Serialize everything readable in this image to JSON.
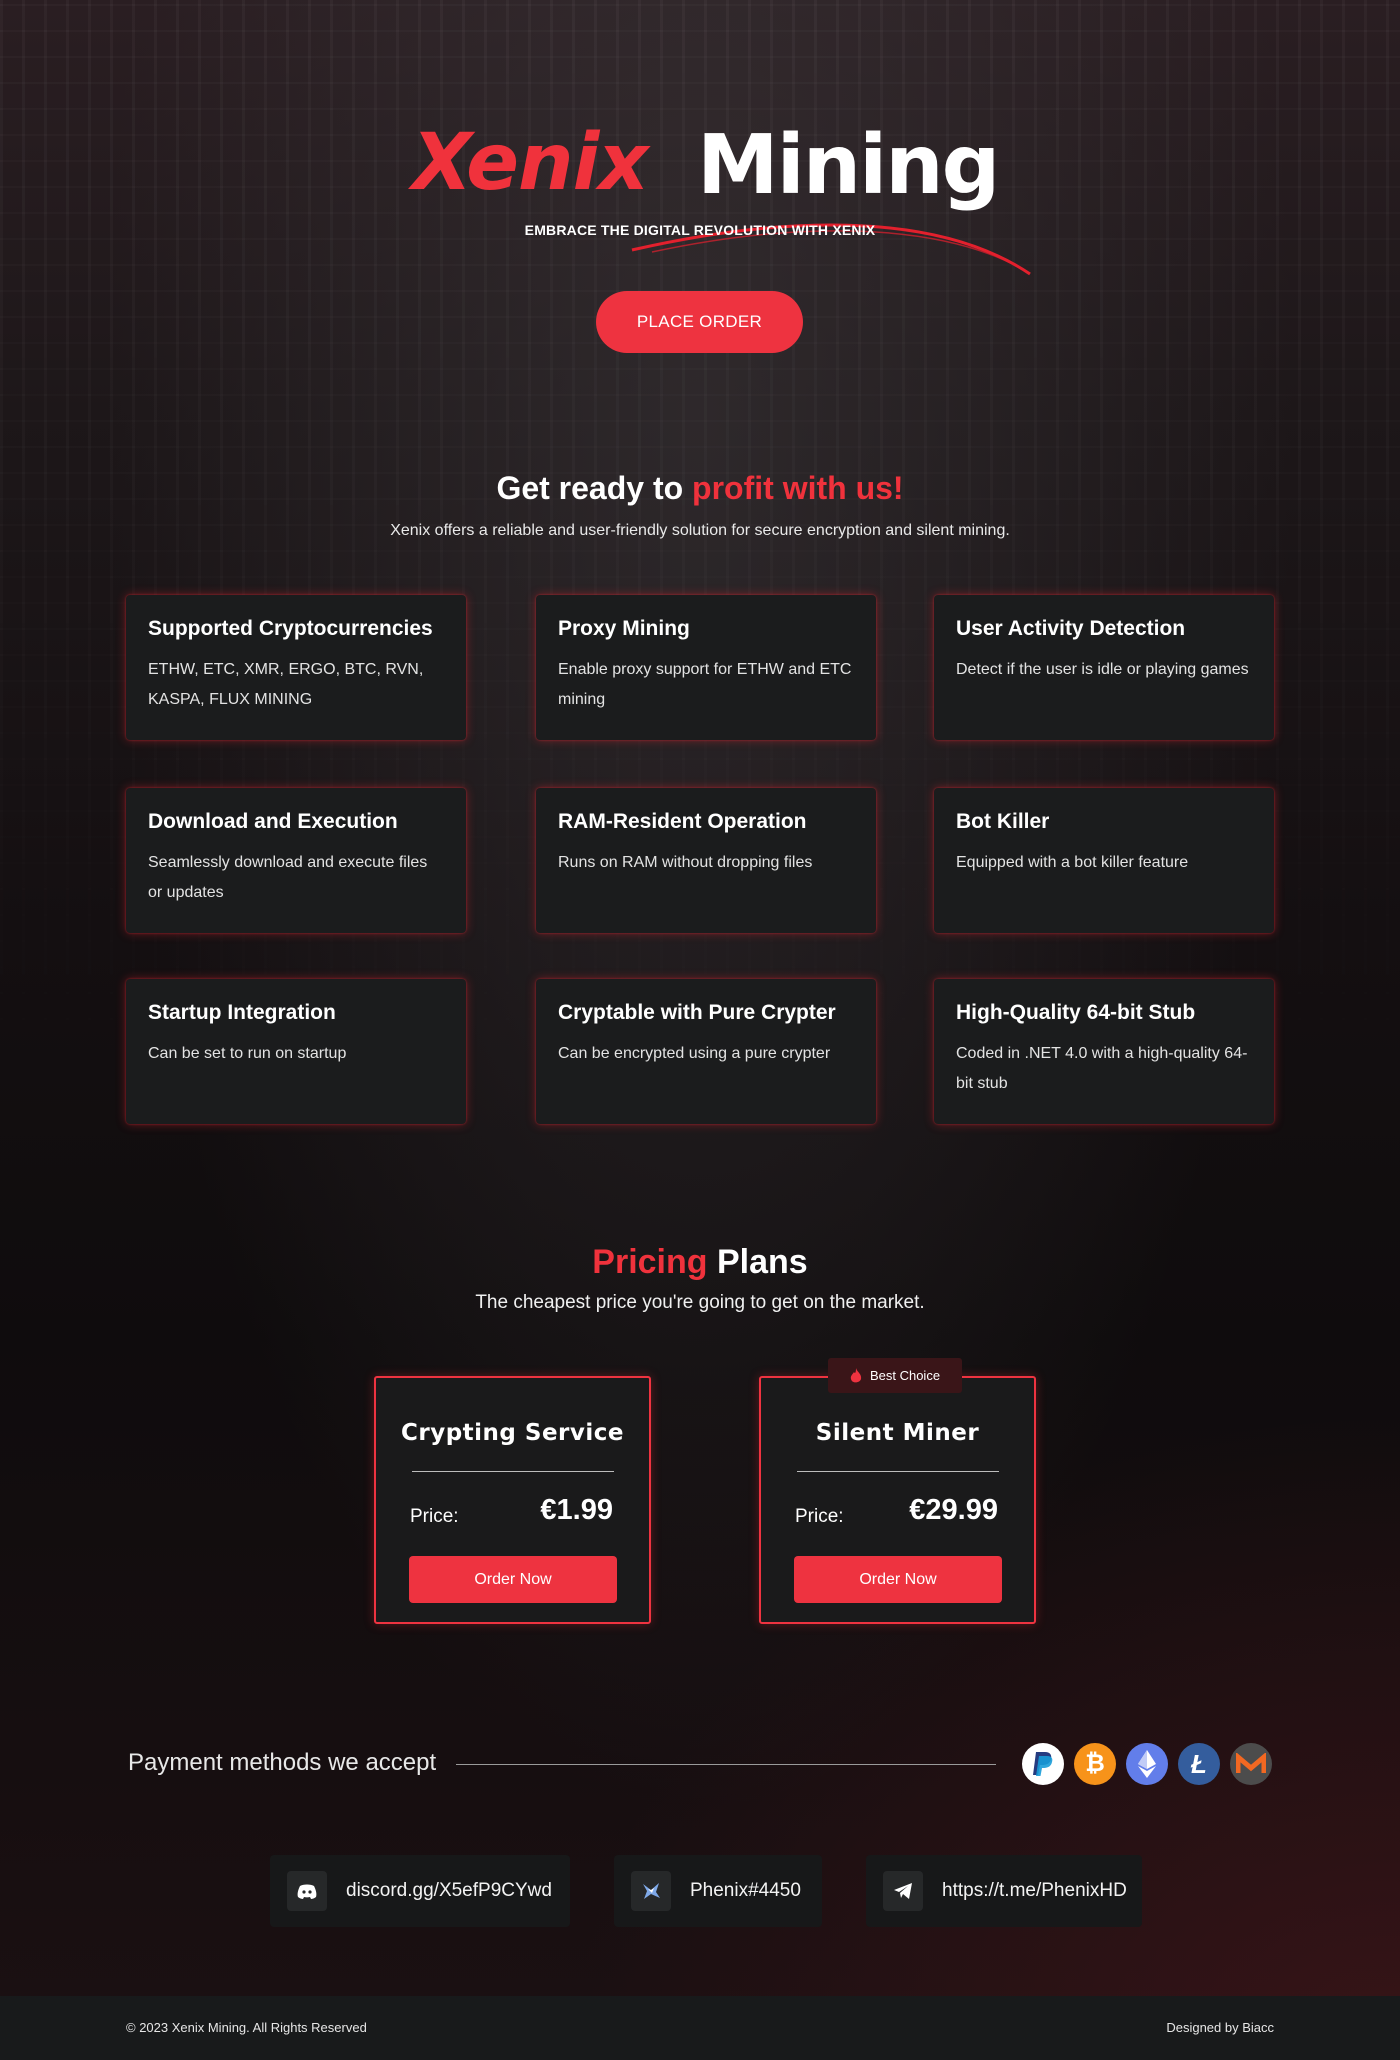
{
  "hero": {
    "logo_word1": "Xenix",
    "logo_word2": "Mining",
    "tagline": "EMBRACE THE DIGITAL REVOLUTION WITH XENIX",
    "cta_label": "PLACE ORDER"
  },
  "intro": {
    "title_plain": "Get ready to ",
    "title_accent": "profit with us!",
    "subtitle": "Xenix offers a reliable and user-friendly solution for secure encryption and silent mining."
  },
  "features": [
    {
      "title": "Supported Cryptocurrencies",
      "text": "ETHW, ETC, XMR, ERGO, BTC, RVN, KASPA, FLUX MINING"
    },
    {
      "title": "Proxy Mining",
      "text": "Enable proxy support for ETHW and ETC mining"
    },
    {
      "title": "User Activity Detection",
      "text": "Detect if the user is idle or playing games"
    },
    {
      "title": "Download and Execution",
      "text": "Seamlessly download and execute files or updates"
    },
    {
      "title": "RAM-Resident Operation",
      "text": "Runs on RAM without dropping files"
    },
    {
      "title": "Bot Killer",
      "text": "Equipped with a bot killer feature"
    },
    {
      "title": "Startup Integration",
      "text": "Can be set to run on startup"
    },
    {
      "title": "Cryptable with Pure Crypter",
      "text": "Can be encrypted using a pure crypter"
    },
    {
      "title": "High-Quality 64-bit Stub",
      "text": "Coded in .NET 4.0 with a high-quality 64-bit stub"
    }
  ],
  "pricing": {
    "title_accent": "Pricing",
    "title_plain": " Plans",
    "subtitle": "The cheapest price you're going to get on the market.",
    "plans": [
      {
        "name": "Crypting Service",
        "price_label": "Price:",
        "price": "€1.99",
        "button": "Order Now"
      },
      {
        "name": "Silent Miner",
        "price_label": "Price:",
        "price": "€29.99",
        "button": "Order Now",
        "badge": "Best Choice"
      }
    ]
  },
  "payment": {
    "label": "Payment methods we accept",
    "methods": [
      {
        "name": "paypal",
        "icon": "paypal-icon",
        "color": "#ffffff"
      },
      {
        "name": "bitcoin",
        "icon": "bitcoin-icon",
        "color": "#f7931a"
      },
      {
        "name": "ethereum",
        "icon": "ethereum-icon",
        "color": "#627eea"
      },
      {
        "name": "litecoin",
        "icon": "litecoin-icon",
        "color": "#345d9d"
      },
      {
        "name": "monero",
        "icon": "monero-icon",
        "color": "#f26822"
      }
    ]
  },
  "contacts": [
    {
      "icon": "discord-icon",
      "text": "discord.gg/X5efP9CYwd"
    },
    {
      "icon": "phenix-icon",
      "text": "Phenix#4450"
    },
    {
      "icon": "telegram-icon",
      "text": "https://t.me/PhenixHD"
    }
  ],
  "footer": {
    "copyright": "© 2023 Xenix Mining. All Rights Reserved",
    "credit": "Designed by Biacc"
  },
  "colors": {
    "accent": "#ee3340",
    "card_bg": "#1b1c1d"
  }
}
